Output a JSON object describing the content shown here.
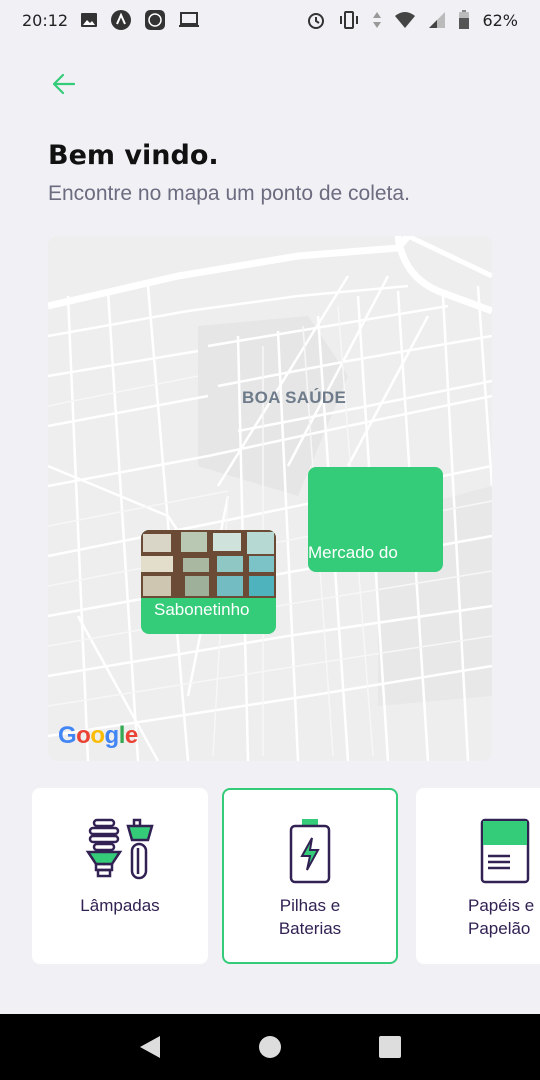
{
  "status_bar": {
    "time": "20:12",
    "battery": "62%",
    "left_icons": [
      "image-icon",
      "app-a-icon",
      "app-box-icon",
      "laptop-icon"
    ],
    "right_icons": [
      "alarm-icon",
      "vibrate-icon",
      "data-arrows-icon",
      "wifi-icon",
      "signal-icon",
      "battery-icon"
    ]
  },
  "header": {
    "back_icon": "arrow-left-icon",
    "title": "Bem vindo.",
    "subtitle": "Encontre no mapa um ponto de coleta."
  },
  "map": {
    "neighborhood": "BOA SAÚDE",
    "google_logo": "Google",
    "markers": [
      {
        "label": "Sabonetinho",
        "has_photo": true
      },
      {
        "label": "Mercado do",
        "has_photo": false
      }
    ]
  },
  "items": [
    {
      "label_line1": "Lâmpadas",
      "label_line2": "",
      "icon": "lamps-icon",
      "selected": false
    },
    {
      "label_line1": "Pilhas e",
      "label_line2": "Baterias",
      "icon": "battery-icon",
      "selected": true
    },
    {
      "label_line1": "Papéis e",
      "label_line2": "Papelão",
      "icon": "paper-icon",
      "selected": false
    }
  ],
  "colors": {
    "accent": "#34cb79",
    "title": "#111111",
    "subtitle": "#6c6c80",
    "item_text": "#322153",
    "background": "#f0f0f5"
  },
  "nav": {
    "back_icon": "nav-back-icon",
    "home_icon": "nav-home-icon",
    "recents_icon": "nav-recents-icon"
  }
}
